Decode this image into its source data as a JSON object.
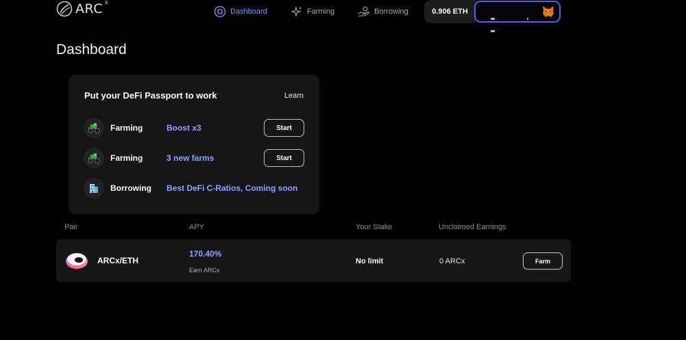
{
  "header": {
    "logo_text": "ARC",
    "logo_sup": "x",
    "nav": [
      {
        "label": "Dashboard",
        "icon": "dashboard-icon",
        "active": true
      },
      {
        "label": "Farming",
        "icon": "sparkle-icon",
        "active": false
      },
      {
        "label": "Borrowing",
        "icon": "borrowing-hand-icon",
        "active": false
      }
    ],
    "balance": "0.906 ETH",
    "wallet_icon": "metamask-fox-icon"
  },
  "page_title": "Dashboard",
  "passport": {
    "title": "Put your DeFi Passport to work",
    "learn": "Learn",
    "rows": [
      {
        "icon": "tractor-icon",
        "label": "Farming",
        "desc": "Boost x3",
        "button": "Start"
      },
      {
        "icon": "tractor-icon",
        "label": "Farming",
        "desc": "3 new farms",
        "button": "Start"
      },
      {
        "icon": "bank-building-icon",
        "label": "Borrowing",
        "desc": "Best DeFi C-Ratios, Coming soon",
        "button": null
      }
    ]
  },
  "table": {
    "headers": [
      "Pair",
      "APY",
      "Your Stake",
      "Unclaimed Earnings"
    ],
    "rows": [
      {
        "icon": "arcx-eth-icon",
        "pair": "ARCx/ETH",
        "apy": "170.40%",
        "apy_sub": "Earn ARCx",
        "stake": "No limit",
        "earnings": "0 ARCx",
        "button": "Farm"
      }
    ]
  },
  "colors": {
    "accent": "#8ea3ff",
    "nav_active": "#7c9aff",
    "wallet_border": "#4a66e8",
    "card_bg": "#151517"
  }
}
